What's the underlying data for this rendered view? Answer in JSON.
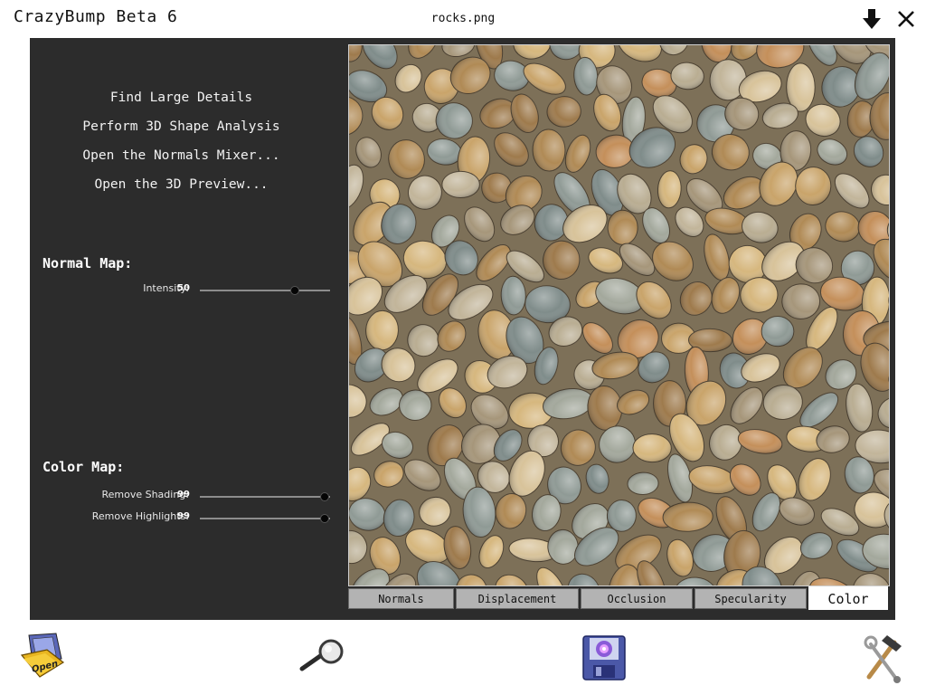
{
  "titlebar": {
    "app_title": "CrazyBump Beta 6",
    "file_name": "rocks.png",
    "minimize_icon": "down-arrow-icon",
    "close_icon": "close-x-icon"
  },
  "actions": [
    {
      "label": "Find Large Details"
    },
    {
      "label": "Perform 3D Shape Analysis"
    },
    {
      "label": "Open the Normals Mixer..."
    },
    {
      "label": "Open the 3D Preview..."
    }
  ],
  "normal_map": {
    "title": "Normal Map:",
    "sliders": [
      {
        "label": "Intensity:",
        "value": "50",
        "fraction": 0.73
      }
    ]
  },
  "color_map": {
    "title": "Color Map:",
    "sliders": [
      {
        "label": "Remove Shading:",
        "value": "99",
        "fraction": 0.96
      },
      {
        "label": "Remove Highlights:",
        "value": "99",
        "fraction": 0.96
      }
    ]
  },
  "tabs": [
    {
      "label": "Normals",
      "active": false
    },
    {
      "label": "Displacement",
      "active": false
    },
    {
      "label": "Occlusion",
      "active": false
    },
    {
      "label": "Specularity",
      "active": false
    },
    {
      "label": "Color",
      "active": true
    }
  ],
  "bottom_toolbar": {
    "open_label": "Open",
    "icons": [
      "open-folder-icon",
      "magnifier-icon",
      "floppy-save-icon",
      "tools-icon"
    ]
  },
  "colors": {
    "panel_bg": "#2c2c2c",
    "text_light": "#f2f2f2",
    "tab_inactive": "#b3b3b3",
    "tab_active": "#ffffff"
  }
}
